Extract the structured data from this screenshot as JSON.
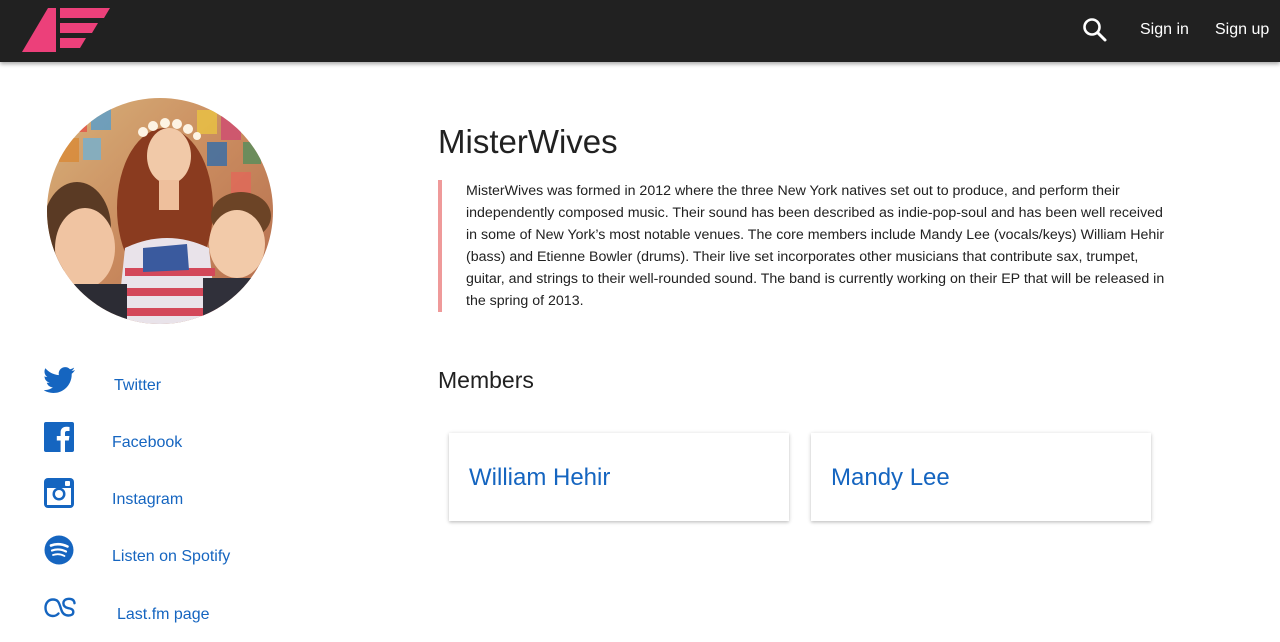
{
  "header": {
    "logo_icon": "brand-logo-icon",
    "search_icon": "search-icon",
    "signin_label": "Sign in",
    "signup_label": "Sign up",
    "background": "#212121",
    "logo_color": "#ec407a"
  },
  "artist": {
    "name": "MisterWives",
    "bio": "MisterWives was formed in 2012 where the three New York natives set out to produce, and perform their independently composed music. Their sound has been described as indie-pop-soul and has been well received in some of New York’s most notable venues. The core members include Mandy Lee (vocals/keys) William Hehir (bass) and Etienne Bowler (drums). Their live set incorporates other musicians that contribute sax, trumpet, guitar, and strings to their well-rounded sound. The band is currently working on their EP that will be released in the spring of 2013.",
    "bio_border_color": "#ef9a9a"
  },
  "social_links": [
    {
      "label": "Twitter",
      "icon": "twitter-icon"
    },
    {
      "label": "Facebook",
      "icon": "facebook-icon"
    },
    {
      "label": "Instagram",
      "icon": "instagram-icon"
    },
    {
      "label": "Listen on Spotify",
      "icon": "spotify-icon"
    },
    {
      "label": "Last.fm page",
      "icon": "lastfm-icon"
    }
  ],
  "members": {
    "heading": "Members",
    "list": [
      {
        "name": "William Hehir"
      },
      {
        "name": "Mandy Lee"
      }
    ]
  },
  "colors": {
    "link": "#1565c0",
    "text": "#212121"
  }
}
